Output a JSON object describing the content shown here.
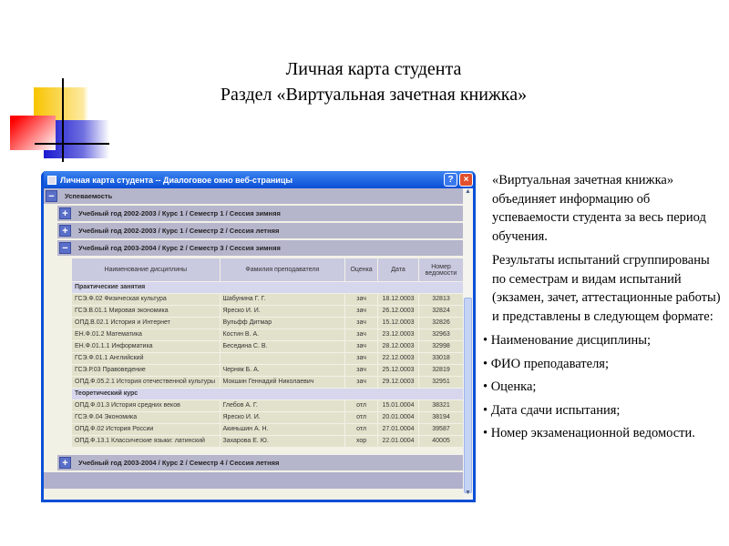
{
  "slide_title": [
    "Личная карта студента",
    "Раздел «Виртуальная зачетная книжка»"
  ],
  "window": {
    "title": "Личная карта студента -- Диалоговое окно веб-страницы",
    "help": "?",
    "close": "×"
  },
  "section": "Успеваемость",
  "semesters": [
    "Учебный год 2002-2003 / Курс 1 / Семестр 1 / Сессия зимняя",
    "Учебный год 2002-2003 / Курс 1 / Семестр 2 / Сессия летняя",
    "Учебный год 2003-2004 / Курс 2 / Семестр 3 / Сессия зимняя",
    "Учебный год 2003-2004 / Курс 2 / Семестр 4 / Сессия летняя"
  ],
  "columns": [
    "Наименование дисциплины",
    "Фамилия преподавателя",
    "Оценка",
    "Дата",
    "Номер ведомости"
  ],
  "groups": [
    {
      "name": "Практические занятия",
      "rows": [
        [
          "ГСЭ.Ф.02 Физическая культура",
          "Шабунина Г. Г.",
          "зач",
          "18.12.0003",
          "32813"
        ],
        [
          "ГСЭ.В.01.1 Мировая экономика",
          "Яреско И. И.",
          "зач",
          "26.12.0003",
          "32824"
        ],
        [
          "ОПД.В.02.1 История и Интернет",
          "Вульфф Дитмар",
          "зач",
          "15.12.0003",
          "32826"
        ],
        [
          "ЕН.Ф.01.2 Математика",
          "Костин В. А.",
          "зач",
          "23.12.0003",
          "32963"
        ],
        [
          "ЕН.Ф.01.1.1 Информатика",
          "Беседина С. В.",
          "зач",
          "28.12.0003",
          "32998"
        ],
        [
          "ГСЭ.Ф.01.1 Английский",
          "",
          "зач",
          "22.12.0003",
          "33018"
        ],
        [
          "ГСЭ.Р.03 Правоведение",
          "Черняк Б. А.",
          "зач",
          "25.12.0003",
          "32819"
        ],
        [
          "ОПД.Ф.05.2.1 История отечественной культуры",
          "Мокшин Геннадий Николаевич",
          "зач",
          "29.12.0003",
          "32951"
        ]
      ]
    },
    {
      "name": "Теоретический курс",
      "rows": [
        [
          "ОПД.Ф.01.3 История средних веков",
          "Глебов А. Г.",
          "отл",
          "15.01.0004",
          "38321"
        ],
        [
          "ГСЭ.Ф.04 Экономика",
          "Яреско И. И.",
          "отл",
          "20.01.0004",
          "38194"
        ],
        [
          "ОПД.Ф.02 История России",
          "Акиньшин А. Н.",
          "отл",
          "27.01.0004",
          "39587"
        ],
        [
          "ОПД.Ф.13.1 Классические языки: латинский",
          "Захарова Е. Ю.",
          "хор",
          "22.01.0004",
          "40005"
        ]
      ]
    }
  ],
  "description": {
    "paragraphs": [
      "«Виртуальная зачетная книжка» объединяет информацию об успеваемости студента за весь период обучения.",
      "Результаты испытаний сгруппированы по семестрам и видам испытаний (экзамен, зачет, аттестационные работы) и представлены в следующем формате:"
    ],
    "bullets": [
      "Наименование дисциплины;",
      "ФИО преподавателя;",
      "Оценка;",
      "Дата сдачи испытания;",
      "Номер экзаменационной ведомости."
    ]
  }
}
